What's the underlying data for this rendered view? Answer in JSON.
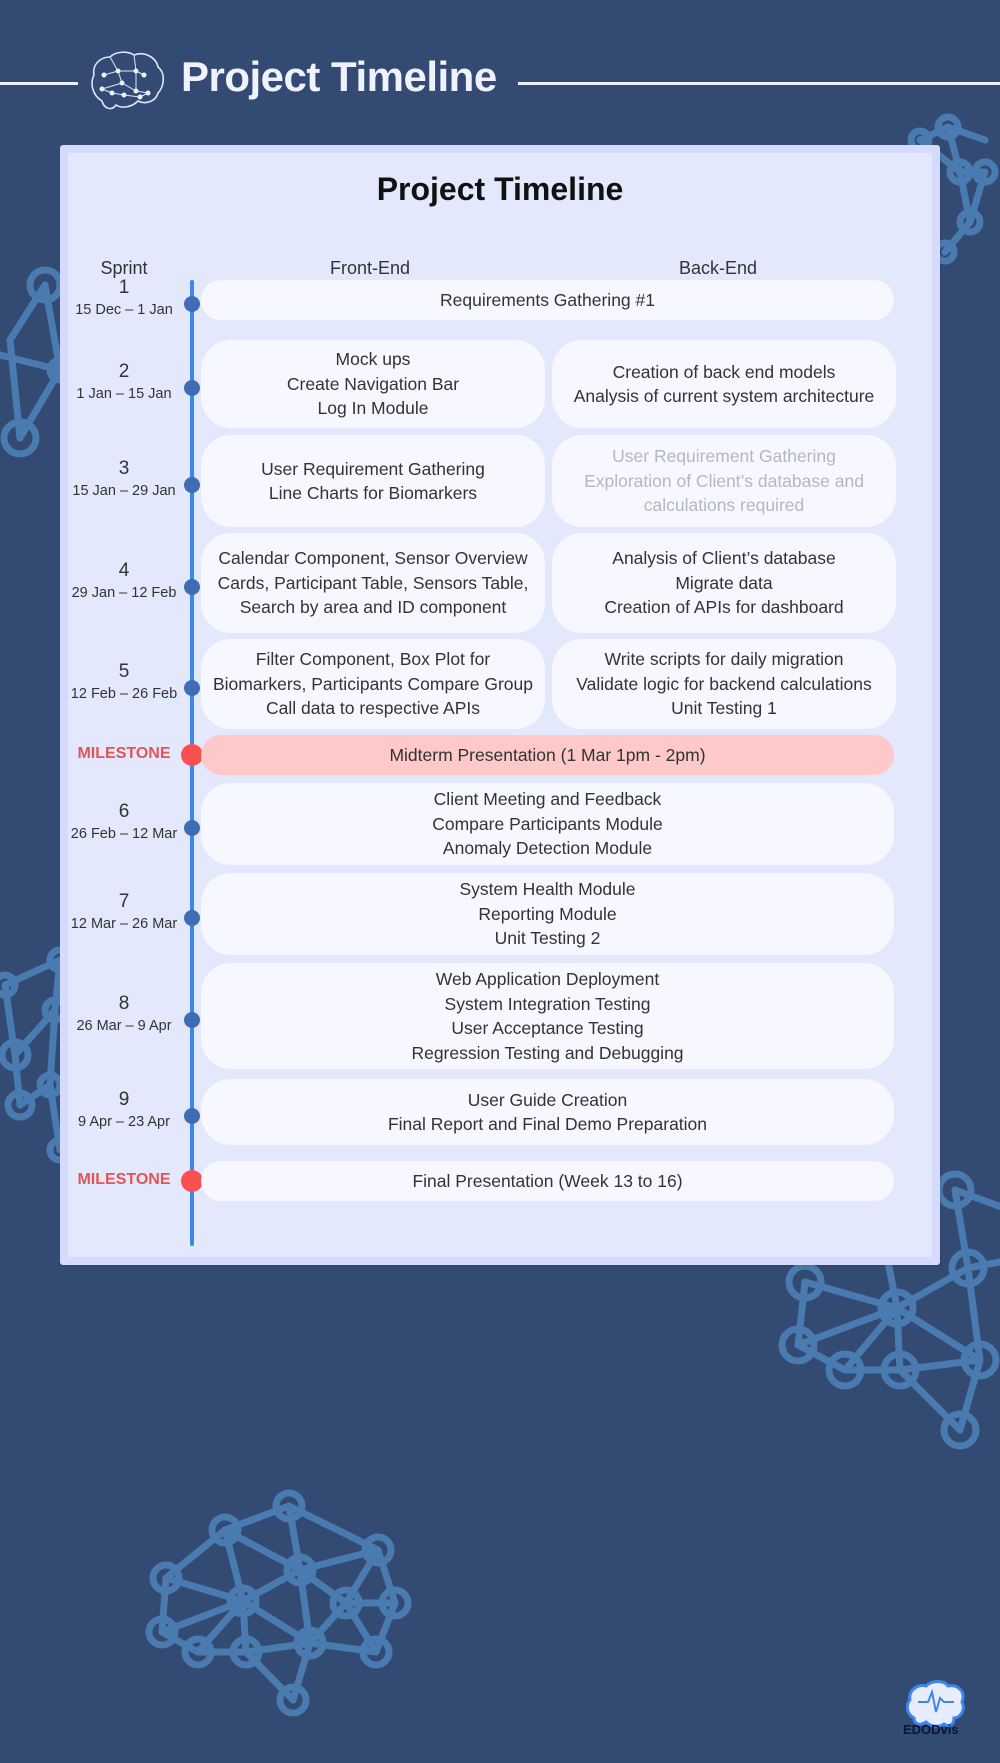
{
  "header": {
    "title": "Project Timeline",
    "brain_icon": "brain-network-icon"
  },
  "card": {
    "title": "Project Timeline",
    "columns": {
      "sprint": "Sprint",
      "front_end": "Front-End",
      "back_end": "Back-End"
    }
  },
  "rows": [
    {
      "type": "sprint",
      "sprint": "1",
      "dates": "15 Dec – 1 Jan",
      "span": [
        "Requirements Gathering #1"
      ]
    },
    {
      "type": "sprint",
      "sprint": "2",
      "dates": "1 Jan – 15 Jan",
      "front_end": [
        "Mock ups",
        "Create Navigation Bar",
        "Log In Module"
      ],
      "back_end": [
        "Creation of back end models",
        "Analysis of current system architecture"
      ]
    },
    {
      "type": "sprint",
      "sprint": "3",
      "dates": "15 Jan – 29 Jan",
      "front_end": [
        "User Requirement Gathering",
        "Line Charts for Biomarkers"
      ],
      "back_end": [
        "User Requirement Gathering",
        "Exploration of Client’s database and",
        "calculations required"
      ],
      "back_end_muted": true
    },
    {
      "type": "sprint",
      "sprint": "4",
      "dates": "29 Jan – 12 Feb",
      "front_end": [
        "Calendar Component, Sensor Overview",
        "Cards, Participant Table, Sensors Table,",
        "Search by area and ID component"
      ],
      "back_end": [
        "Analysis of Client’s database",
        "Migrate data",
        "Creation of APIs for dashboard"
      ]
    },
    {
      "type": "sprint",
      "sprint": "5",
      "dates": "12 Feb – 26 Feb",
      "front_end": [
        "Filter Component, Box Plot for",
        "Biomarkers, Participants Compare Group",
        "Call data to respective APIs"
      ],
      "back_end": [
        "Write scripts for daily migration",
        "Validate logic for backend calculations",
        "Unit Testing 1"
      ]
    },
    {
      "type": "milestone",
      "label": "MILESTONE",
      "span": [
        "Midterm Presentation (1 Mar 1pm - 2pm)"
      ],
      "highlight": true
    },
    {
      "type": "sprint",
      "sprint": "6",
      "dates": "26 Feb – 12 Mar",
      "span": [
        "Client Meeting and Feedback",
        "Compare Participants Module",
        "Anomaly Detection Module"
      ]
    },
    {
      "type": "sprint",
      "sprint": "7",
      "dates": "12 Mar – 26 Mar",
      "span": [
        "System Health Module",
        "Reporting Module",
        "Unit Testing 2"
      ]
    },
    {
      "type": "sprint",
      "sprint": "8",
      "dates": "26 Mar – 9 Apr",
      "span": [
        "Web Application Deployment",
        "System Integration Testing",
        "User Acceptance Testing",
        "Regression Testing and Debugging"
      ]
    },
    {
      "type": "sprint",
      "sprint": "9",
      "dates": "9 Apr – 23 Apr",
      "span": [
        "User Guide Creation",
        "Final Report and Final Demo Preparation"
      ]
    },
    {
      "type": "milestone",
      "label": "MILESTONE",
      "span": [
        "Final Presentation (Week 13 to 16)"
      ],
      "highlight": false
    }
  ],
  "footer": {
    "logo_text": "EDODvis"
  },
  "colors": {
    "background": "#334a72",
    "card": "#e4e8fc",
    "pill": "#f7f8ff",
    "milestone_pill": "#fdc9c9",
    "timeline_line": "#3d86f0",
    "sprint_dot": "#3f6db3",
    "milestone_dot": "#fb5050",
    "milestone_text": "#e05656",
    "network_deco": "#4a7bb0"
  }
}
